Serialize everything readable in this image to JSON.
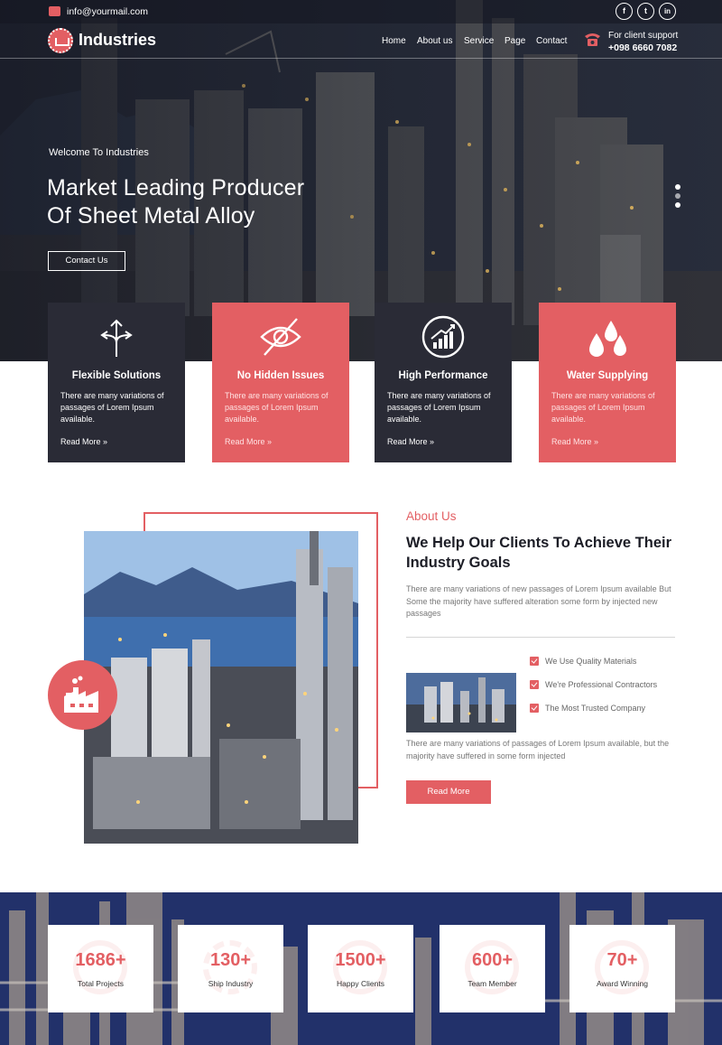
{
  "topbar": {
    "email": "info@yourmail.com",
    "social": [
      "f",
      "t",
      "in"
    ]
  },
  "header": {
    "brand": "Industries",
    "nav": [
      "Home",
      "About us",
      "Service",
      "Page",
      "Contact"
    ],
    "support_label": "For client support",
    "support_phone": "+098 6660 7082"
  },
  "hero": {
    "welcome": "Welcome To Industries",
    "headline_line1": "Market Leading Producer",
    "headline_line2": "Of Sheet Metal Alloy",
    "cta": "Contact Us"
  },
  "features": [
    {
      "title": "Flexible Solutions",
      "desc": "There are many variations of passages of Lorem Ipsum available.",
      "more": "Read More",
      "icon": "arrows-split-icon"
    },
    {
      "title": "No Hidden Issues",
      "desc": "There are many variations of passages of Lorem Ipsum available.",
      "more": "Read More",
      "icon": "eye-slash-icon"
    },
    {
      "title": "High Performance",
      "desc": "There are many variations of passages of Lorem Ipsum available.",
      "more": "Read More",
      "icon": "growth-chart-icon"
    },
    {
      "title": "Water Supplying",
      "desc": "There are many variations of passages of Lorem Ipsum available.",
      "more": "Read More",
      "icon": "water-drops-icon"
    }
  ],
  "about": {
    "kicker": "About Us",
    "title": "We Help Our Clients To Achieve Their Industry Goals",
    "text": "There are many variations of new passages of Lorem Ipsum available But Some the majority have suffered alteration some form by injected new passages",
    "checks": [
      "We Use Quality Materials",
      "We're Professional Contractors",
      "The Most Trusted Company"
    ],
    "text2": "There are many variations of passages of Lorem Ipsum available, but the majority have suffered in some form injected",
    "button": "Read More"
  },
  "stats": [
    {
      "value": "1686+",
      "label": "Total Projects"
    },
    {
      "value": "130+",
      "label": "Ship Industry"
    },
    {
      "value": "1500+",
      "label": "Happy Clients"
    },
    {
      "value": "600+",
      "label": "Team Member"
    },
    {
      "value": "70+",
      "label": "Award Winning"
    }
  ],
  "colors": {
    "accent": "#e35f63",
    "dark": "#2a2b36"
  }
}
